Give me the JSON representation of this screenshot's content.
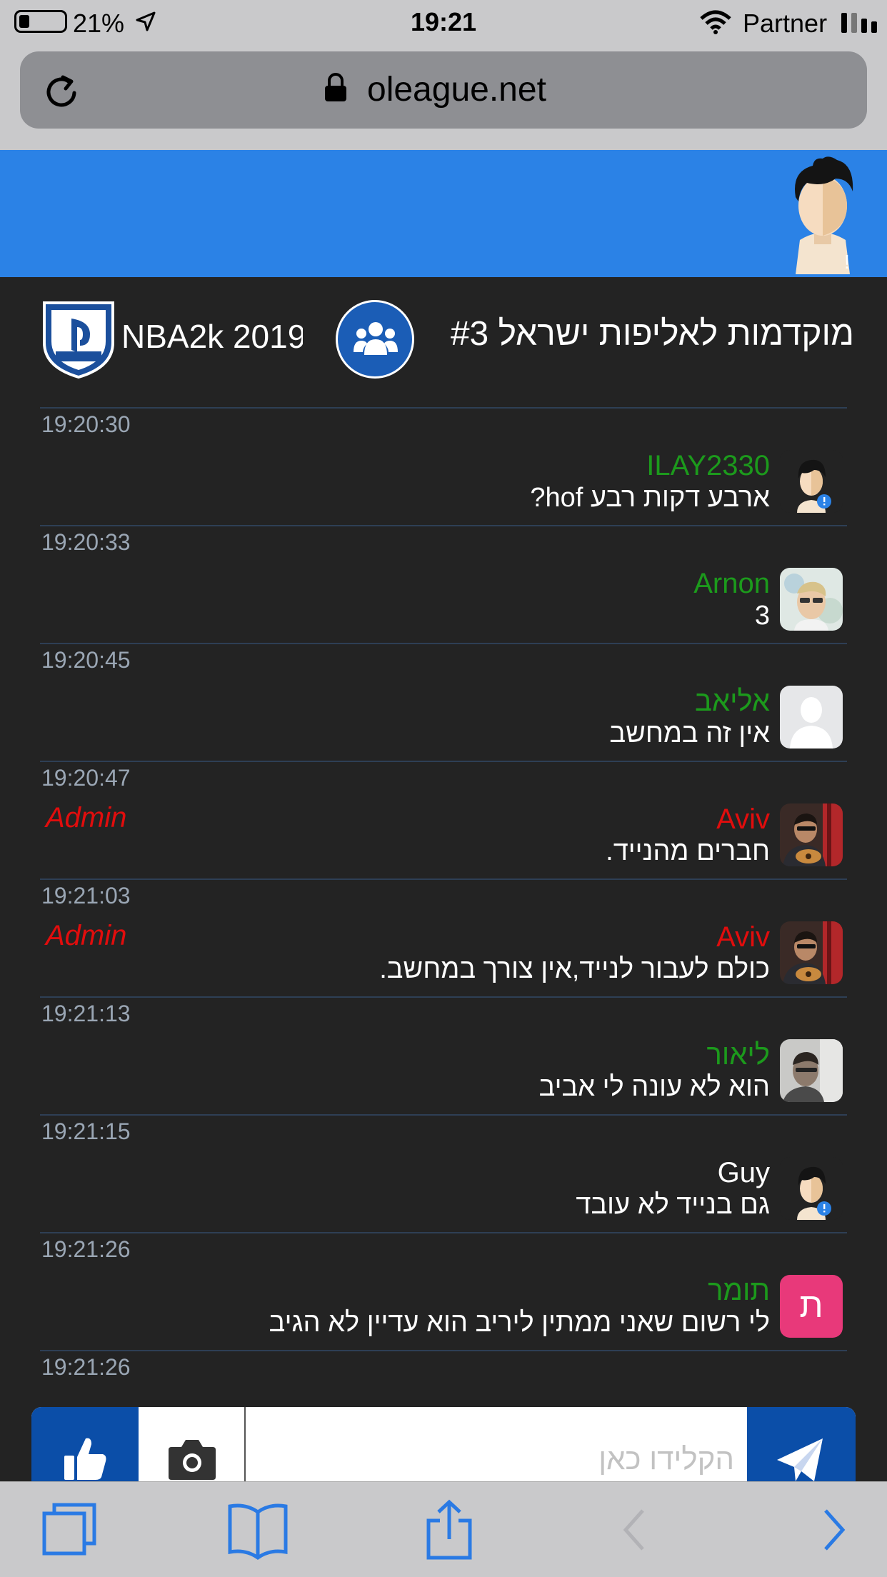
{
  "status_bar": {
    "battery": "21%",
    "time": "19:21",
    "carrier": "Partner"
  },
  "browser": {
    "url": "oleague.net"
  },
  "room": {
    "game": "NBA2k 2019",
    "title": "מוקדמות לאליפות ישראל #3"
  },
  "messages": [
    {
      "time": "19:20:30",
      "name": "ILAY2330",
      "text": "ארבע דקות רבע hof?",
      "name_color": "green",
      "avatar": "default-cartoon-avatar",
      "role": ""
    },
    {
      "time": "19:20:33",
      "name": "Arnon",
      "text": "3",
      "name_color": "green",
      "avatar": "user-photo",
      "role": ""
    },
    {
      "time": "19:20:45",
      "name": "אליאב",
      "text": "אין זה במחשב",
      "name_color": "green",
      "avatar": "silhouette-avatar",
      "role": ""
    },
    {
      "time": "19:20:47",
      "name": "Aviv",
      "text": "חברים מהנייד.",
      "name_color": "red",
      "avatar": "user-photo",
      "role": "Admin"
    },
    {
      "time": "19:21:03",
      "name": "Aviv",
      "text": "כולם לעבור לנייד,אין צורך במחשב.",
      "name_color": "red",
      "avatar": "user-photo",
      "role": "Admin"
    },
    {
      "time": "19:21:13",
      "name": "ליאור",
      "text": "הוא לא עונה לי אביב",
      "name_color": "green",
      "avatar": "user-photo",
      "role": ""
    },
    {
      "time": "19:21:15",
      "name": "Guy",
      "text": "גם בנייד לא עובד",
      "name_color": "white",
      "avatar": "default-cartoon-avatar",
      "role": ""
    },
    {
      "time": "19:21:26",
      "name": "תומר",
      "text": "לי רשום שאני ממתין ליריב הוא עדיין לא הגיב",
      "name_color": "green",
      "avatar": "letter-avatar",
      "avatar_letter": "ת",
      "role": ""
    }
  ],
  "last_time": "19:21:26",
  "composer": {
    "placeholder": "הקלידו כאן"
  },
  "colors": {
    "header_blue": "#2b82e6",
    "button_blue": "#0b4ea8",
    "name_green": "#1c9a1c",
    "admin_red": "#e10d0d",
    "background": "#232323"
  }
}
